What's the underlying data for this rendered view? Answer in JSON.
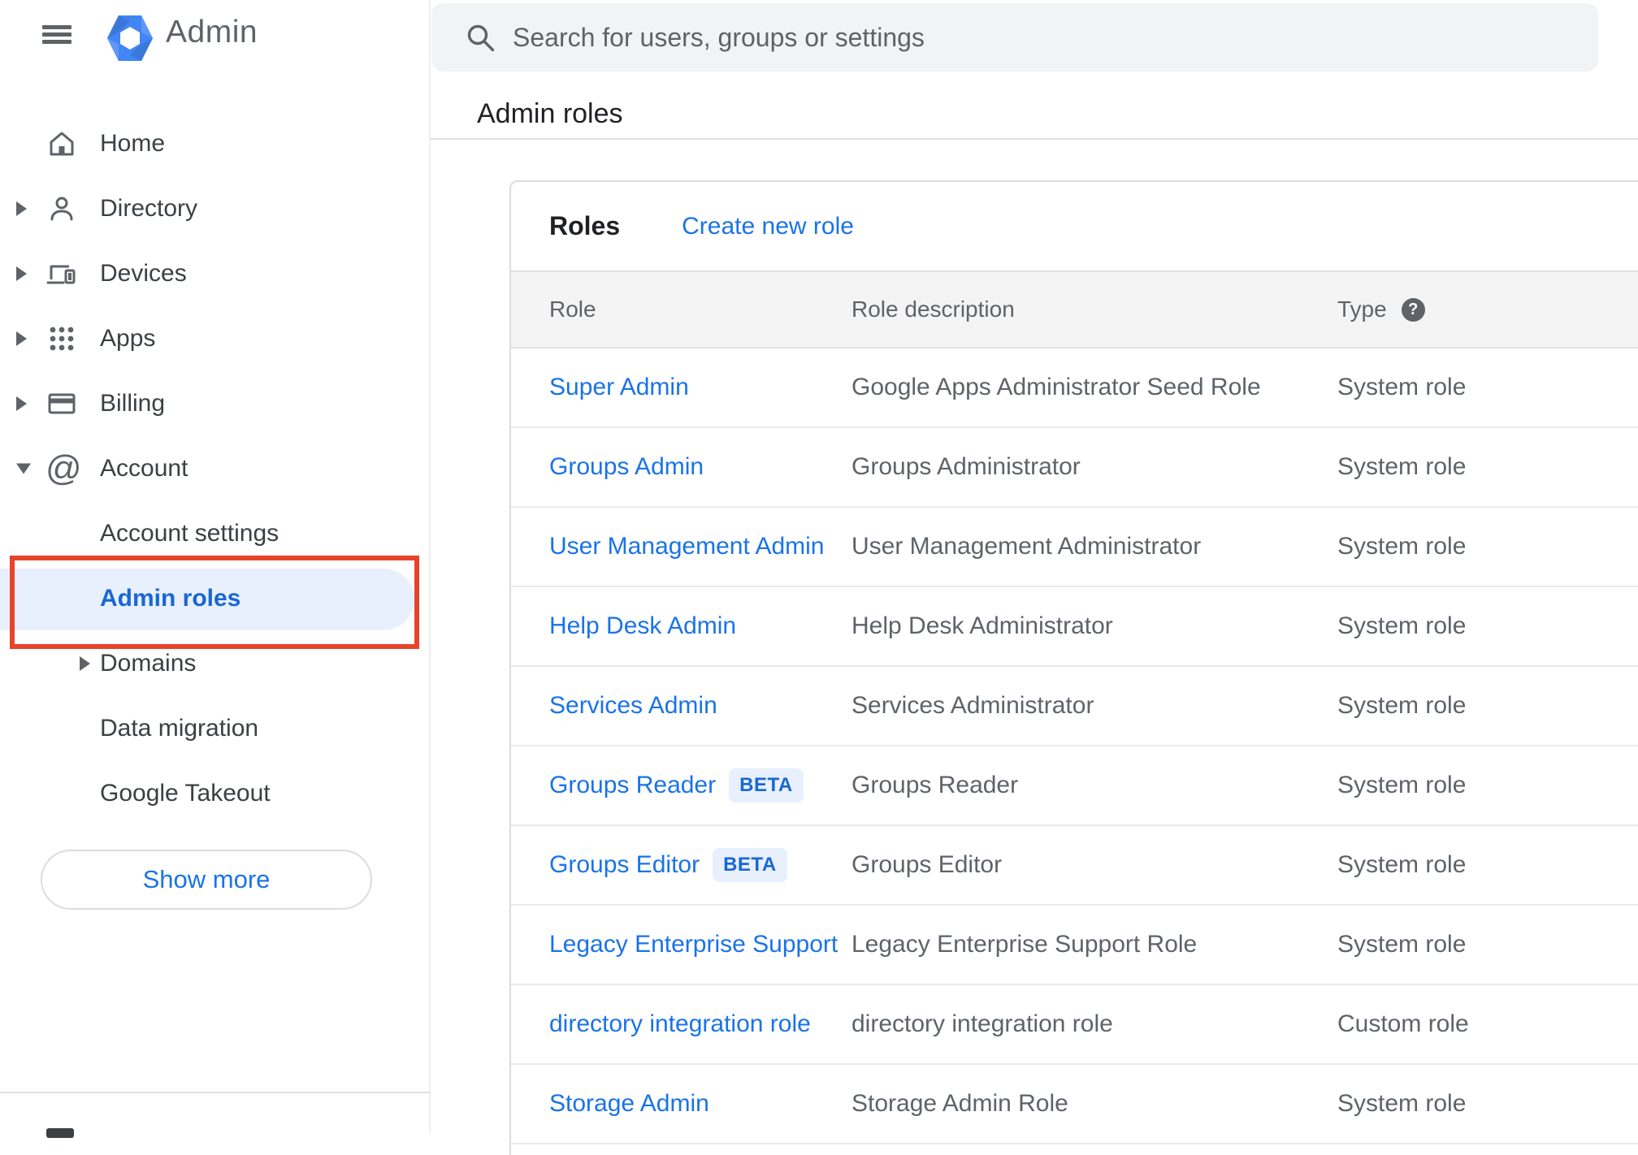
{
  "topbar": {
    "app_title": "Admin",
    "search": {
      "placeholder": "Search for users, groups or settings",
      "icon": "search-icon"
    },
    "menu_icon": "hamburger-menu-icon",
    "logo_icon": "google-admin-logo"
  },
  "breadcrumb": "Admin roles",
  "sidebar": {
    "items": [
      {
        "label": "Home",
        "icon": "home",
        "arrow": "none",
        "level": "main",
        "active": false
      },
      {
        "label": "Directory",
        "icon": "person",
        "arrow": "right",
        "level": "main",
        "active": false
      },
      {
        "label": "Devices",
        "icon": "devices",
        "arrow": "right",
        "level": "main",
        "active": false
      },
      {
        "label": "Apps",
        "icon": "apps",
        "arrow": "right",
        "level": "main",
        "active": false
      },
      {
        "label": "Billing",
        "icon": "card",
        "arrow": "right",
        "level": "main",
        "active": false
      },
      {
        "label": "Account",
        "icon": "at",
        "arrow": "down",
        "level": "main",
        "active": false
      },
      {
        "label": "Account settings",
        "icon": "none",
        "arrow": "none",
        "level": "sub",
        "active": false
      },
      {
        "label": "Admin roles",
        "icon": "none",
        "arrow": "none",
        "level": "sub",
        "active": true
      },
      {
        "label": "Domains",
        "icon": "none",
        "arrow": "right-sub",
        "level": "sub",
        "active": false
      },
      {
        "label": "Data migration",
        "icon": "none",
        "arrow": "none",
        "level": "sub",
        "active": false
      },
      {
        "label": "Google Takeout",
        "icon": "none",
        "arrow": "none",
        "level": "sub",
        "active": false
      }
    ],
    "show_more_label": "Show more",
    "annotation": "red-highlight-box-around-admin-roles"
  },
  "panel": {
    "title": "Roles",
    "action_label": "Create new role",
    "columns": {
      "role": "Role",
      "description": "Role description",
      "type": "Type"
    },
    "type_help_icon": "?",
    "rows": [
      {
        "role": "Super Admin",
        "beta": false,
        "description": "Google Apps Administrator Seed Role",
        "type": "System role"
      },
      {
        "role": "Groups Admin",
        "beta": false,
        "description": "Groups Administrator",
        "type": "System role"
      },
      {
        "role": "User Management Admin",
        "beta": false,
        "description": "User Management Administrator",
        "type": "System role"
      },
      {
        "role": "Help Desk Admin",
        "beta": false,
        "description": "Help Desk Administrator",
        "type": "System role"
      },
      {
        "role": "Services Admin",
        "beta": false,
        "description": "Services Administrator",
        "type": "System role"
      },
      {
        "role": "Groups Reader",
        "beta": true,
        "beta_label": "BETA",
        "description": "Groups Reader",
        "type": "System role"
      },
      {
        "role": "Groups Editor",
        "beta": true,
        "beta_label": "BETA",
        "description": "Groups Editor",
        "type": "System role"
      },
      {
        "role": "Legacy Enterprise Support",
        "beta": false,
        "description": "Legacy Enterprise Support Role",
        "type": "System role"
      },
      {
        "role": "directory integration role",
        "beta": false,
        "description": "directory integration role",
        "type": "Custom role"
      },
      {
        "role": "Storage Admin",
        "beta": false,
        "description": "Storage Admin Role",
        "type": "System role"
      }
    ]
  },
  "colors": {
    "accent_blue": "#1a73e8",
    "active_item_blue": "#1967d2",
    "active_item_bg": "#e8f0fe",
    "annotation_red": "#e8432b",
    "searchbar_bg": "#f1f3f4",
    "table_header_bg": "#f4f4f4",
    "divider": "#e0e0e0",
    "text_primary": "#202124",
    "text_secondary": "#5f6368",
    "logo_blue": "#4285f4"
  }
}
